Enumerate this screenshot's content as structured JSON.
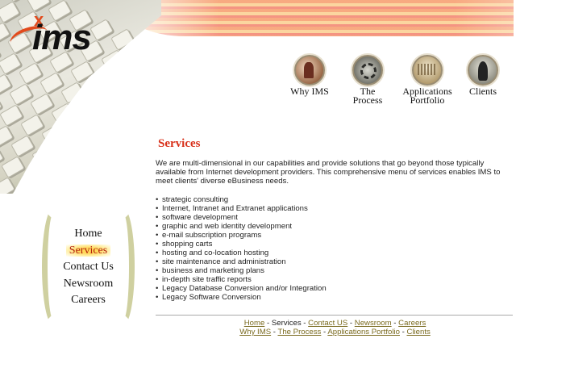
{
  "logo": {
    "text": "ims",
    "mark": "x"
  },
  "top_nav": [
    {
      "label_line1": "Why IMS",
      "label_line2": "",
      "icon": "chess-piece-icon"
    },
    {
      "label_line1": "The",
      "label_line2": "Process",
      "icon": "gear-icon"
    },
    {
      "label_line1": "Applications",
      "label_line2": "Portfolio",
      "icon": "folder-icon"
    },
    {
      "label_line1": "Clients",
      "label_line2": "",
      "icon": "person-icon"
    }
  ],
  "left_nav": [
    "Home",
    "Services",
    "Contact Us",
    "Newsroom",
    "Careers"
  ],
  "left_nav_active": "Services",
  "main": {
    "title": "Services",
    "intro": "We are multi-dimensional in our capabilities and provide solutions that go beyond those typically available from Internet development providers. This comprehensive menu of services enables IMS to meet clients' diverse eBusiness needs.",
    "services": [
      "strategic consulting",
      "Internet, Intranet and Extranet applications",
      "software development",
      "graphic and web identity development",
      "e-mail subscription programs",
      "shopping carts",
      "hosting and co-location hosting",
      "site maintenance and administration",
      "business and marketing plans",
      "in-depth site traffic reports",
      "Legacy Database Conversion and/or Integration",
      "Legacy Software Conversion"
    ]
  },
  "footer": {
    "row1": {
      "home": "Home",
      "services": "Services",
      "contact": "Contact US",
      "newsroom": "Newsroom",
      "careers": "Careers"
    },
    "row2": {
      "why": "Why IMS",
      "process": "The Process",
      "portfolio": "Applications Portfolio",
      "clients": "Clients"
    },
    "separator": " - "
  },
  "colors": {
    "accent": "#d8301a",
    "link": "#7a6a1f",
    "oval": "#cfd0a0",
    "highlight": "#ffd85a"
  }
}
